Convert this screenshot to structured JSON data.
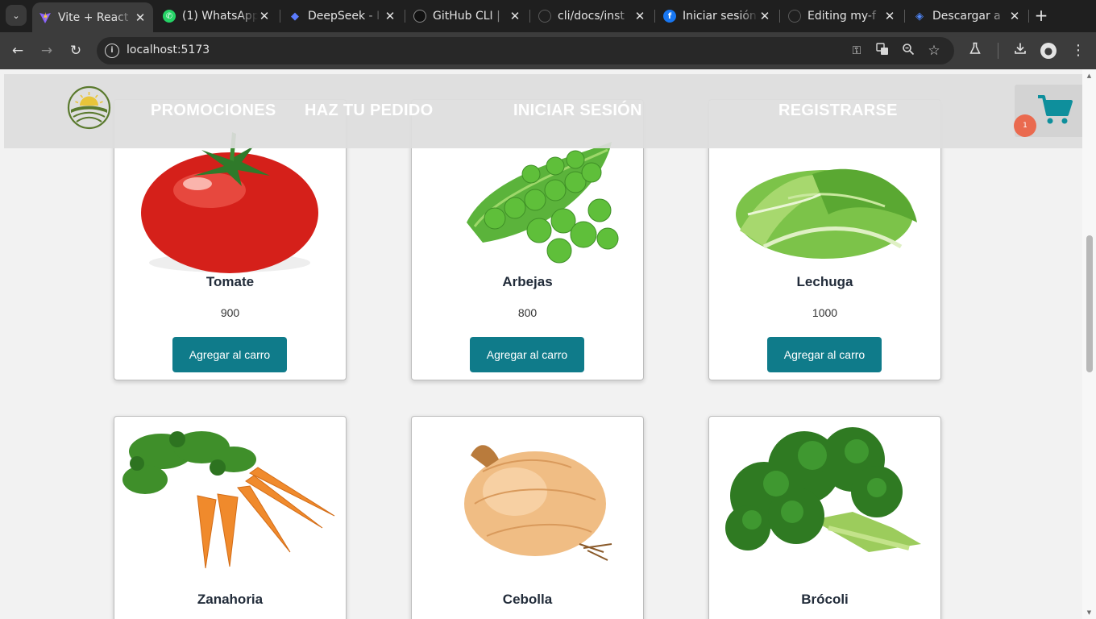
{
  "browser": {
    "tabs": [
      {
        "title": "Vite + React",
        "icon": "vite-icon"
      },
      {
        "title": "(1) WhatsApp",
        "icon": "whatsapp-icon"
      },
      {
        "title": "DeepSeek - I",
        "icon": "deepseek-icon"
      },
      {
        "title": "GitHub CLI |",
        "icon": "github-icon"
      },
      {
        "title": "cli/docs/inst",
        "icon": "github-icon"
      },
      {
        "title": "Iniciar sesión",
        "icon": "facebook-icon"
      },
      {
        "title": "Editing my-f",
        "icon": "github-icon"
      },
      {
        "title": "Descargar a",
        "icon": "gem-icon"
      }
    ],
    "url": "localhost:5173"
  },
  "header": {
    "nav": [
      "PROMOCIONES",
      "HAZ TU PEDIDO",
      "INICIAR SESIÓN",
      "REGISTRARSE"
    ],
    "cart_count": "1"
  },
  "products": [
    {
      "name": "Tomate",
      "price": "900",
      "button": "Agregar al carro",
      "image": "tomato"
    },
    {
      "name": "Arbejas",
      "price": "800",
      "button": "Agregar al carro",
      "image": "peas"
    },
    {
      "name": "Lechuga",
      "price": "1000",
      "button": "Agregar al carro",
      "image": "lettuce"
    },
    {
      "name": "Zanahoria",
      "image": "carrot"
    },
    {
      "name": "Cebolla",
      "image": "onion"
    },
    {
      "name": "Brócoli",
      "image": "broccoli"
    }
  ],
  "colors": {
    "button": "#0f7b8a",
    "cart_icon": "#0e8f9c",
    "badge": "#ea6a4f",
    "logo_green": "#5a7a2e"
  }
}
